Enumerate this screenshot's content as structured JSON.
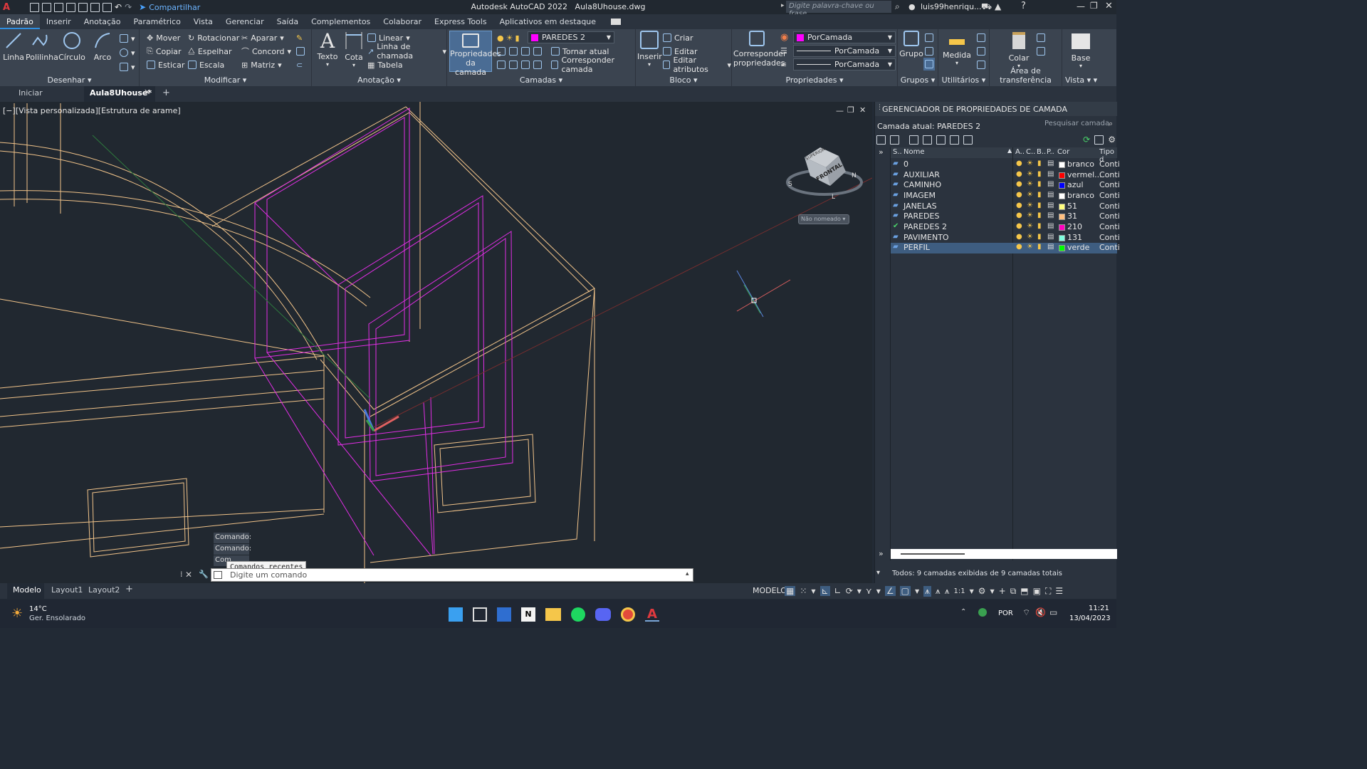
{
  "window": {
    "app_title": "Autodesk AutoCAD 2022",
    "file_title": "Aula8Uhouse.dwg",
    "share_label": "Compartilhar",
    "search_placeholder": "Digite palavra-chave ou frase",
    "user": "luis99henriqu..."
  },
  "menu_tabs": [
    "Padrão",
    "Inserir",
    "Anotação",
    "Paramétrico",
    "Vista",
    "Gerenciar",
    "Saída",
    "Complementos",
    "Colaborar",
    "Express Tools",
    "Aplicativos em destaque"
  ],
  "ribbon": {
    "draw": {
      "title": "Desenhar",
      "line": "Linha",
      "polyline": "Polilinha",
      "circle": "Círculo",
      "arc": "Arco"
    },
    "modify": {
      "title": "Modificar",
      "move": "Mover",
      "rotate": "Rotacionar",
      "trim": "Aparar",
      "copy": "Copiar",
      "mirror": "Espelhar",
      "fillet": "Concord",
      "stretch": "Esticar",
      "scale": "Escala",
      "array": "Matriz"
    },
    "annotation": {
      "title": "Anotação",
      "text": "Texto",
      "dimension": "Cota",
      "linear": "Linear",
      "leader": "Linha de chamada",
      "table": "Tabela"
    },
    "layers": {
      "title": "Camadas",
      "properties_line1": "Propriedades",
      "properties_line2": "da camada",
      "current_layer": "PAREDES 2",
      "make_current": "Tornar atual",
      "match_layer": "Corresponder camada"
    },
    "block": {
      "title": "Bloco",
      "insert": "Inserir",
      "create": "Criar",
      "edit": "Editar",
      "edit_attributes": "Editar atributos"
    },
    "properties": {
      "title": "Propriedades",
      "match_line1": "Corresponder",
      "match_line2": "propriedades",
      "color": "PorCamada",
      "linetype": "PorCamada",
      "lineweight": "PorCamada"
    },
    "groups": {
      "title": "Grupos",
      "group": "Grupo"
    },
    "utilities": {
      "title": "Utilitários",
      "measure": "Medida"
    },
    "clipboard": {
      "title": "Área de transferência",
      "paste": "Colar"
    },
    "view": {
      "title": "Vista",
      "base": "Base"
    }
  },
  "file_tabs": {
    "start": "Iniciar",
    "current": "Aula8Uhouse*"
  },
  "viewport": {
    "label": "[−][Vista personalizada][Estrutura de arame]",
    "viewcube_top": "SUPERIOR",
    "viewcube_front": "FRONTAL",
    "ucs_name": "Não nomeado",
    "history": [
      "Comando:",
      "Comando:",
      "Com"
    ],
    "recent_tooltip": "Comandos recentes",
    "command_placeholder": "Digite um comando"
  },
  "layer_palette": {
    "title": "GERENCIADOR DE PROPRIEDADES DE CAMADA",
    "current_label": "Camada atual: PAREDES 2",
    "search_placeholder": "Pesquisar camada",
    "columns": {
      "status": "S..",
      "name": "Nome",
      "on": "A..",
      "freeze": "C..",
      "lock": "B..",
      "plot": "P..",
      "color": "Cor",
      "linetype": "Tipo d"
    },
    "layers": [
      {
        "name": "0",
        "color": "branco",
        "hex": "#ffffff",
        "linetype": "Conti"
      },
      {
        "name": "AUXILIAR",
        "color": "vermel...",
        "hex": "#ff0000",
        "linetype": "Conti"
      },
      {
        "name": "CAMINHO",
        "color": "azul",
        "hex": "#0000ff",
        "linetype": "Conti"
      },
      {
        "name": "IMAGEM",
        "color": "branco",
        "hex": "#ffffff",
        "linetype": "Conti"
      },
      {
        "name": "JANELAS",
        "color": "51",
        "hex": "#ffff7f",
        "linetype": "Conti"
      },
      {
        "name": "PAREDES",
        "color": "31",
        "hex": "#ffbf7f",
        "linetype": "Conti"
      },
      {
        "name": "PAREDES 2",
        "color": "210",
        "hex": "#ff00bf",
        "linetype": "Conti"
      },
      {
        "name": "PAVIMENTO",
        "color": "131",
        "hex": "#7fffdf",
        "linetype": "Conti"
      },
      {
        "name": "PERFIL",
        "color": "verde",
        "hex": "#00ff00",
        "linetype": "Conti"
      }
    ],
    "footer": "Todos: 9 camadas exibidas de 9 camadas totais"
  },
  "layout_tabs": [
    "Modelo",
    "Layout1",
    "Layout2"
  ],
  "status_bar": {
    "mode": "MODELO",
    "scale": "1:1"
  },
  "taskbar": {
    "temperature": "14°C",
    "weather": "Ger. Ensolarado",
    "language": "POR",
    "time": "11:21",
    "date": "13/04/2023"
  },
  "colors": {
    "accent": "#2f8ee0",
    "wall_lines": "#f2c48a",
    "walls2_lines": "#e22ee6",
    "selection": "#3e5d80"
  }
}
